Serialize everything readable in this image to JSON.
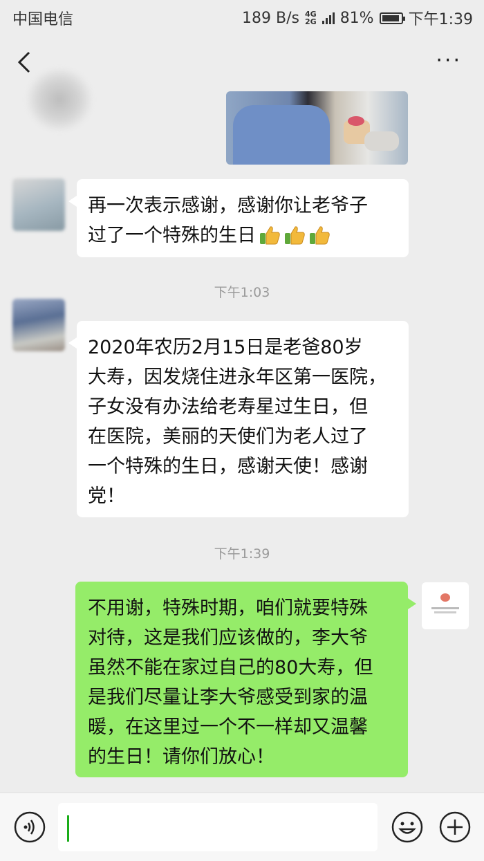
{
  "status_bar": {
    "carrier": "中国电信",
    "speed": "189 B/s",
    "network_top": "4G",
    "network_bottom": "2G",
    "battery": "81%",
    "time": "下午1:39"
  },
  "messages": [
    {
      "text": "再一次表示感谢，感谢你让老爷子\n过了一个特殊的生日"
    },
    {
      "timestamp": "下午1:03"
    },
    {
      "text": "2020年农历2月15日是老爸80岁\n大寿，因发烧住进永年区第一医院，\n子女没有办法给老寿星过生日，但\n在医院，美丽的天使们为老人过了\n一个特殊的生日，感谢天使！感谢\n党！"
    },
    {
      "timestamp": "下午1:39"
    },
    {
      "text": "不用谢，特殊时期，咱们就要特殊\n对待，这是我们应该做的，李大爷\n虽然不能在家过自己的80大寿，但\n是我们尽量让李大爷感受到家的温\n暖，在这里过一个不一样却又温馨\n的生日！请你们放心！"
    }
  ],
  "icons": {
    "back": "chevron-left-icon",
    "more": "more-dots-icon",
    "voice": "voice-icon",
    "emoji": "emoji-icon",
    "plus": "plus-icon",
    "thumbs": "thumbs-up-icon"
  },
  "colors": {
    "out_bubble": "#95ec69",
    "in_bubble": "#ffffff",
    "background": "#ededed"
  }
}
